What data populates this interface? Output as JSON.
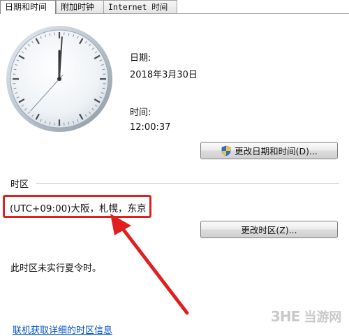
{
  "tabs": [
    {
      "label": "日期和时间",
      "active": true
    },
    {
      "label": "附加时钟",
      "active": false
    },
    {
      "label": "Internet 时间",
      "active": false
    }
  ],
  "clock": {
    "hour": 12,
    "minute": 0,
    "second": 37
  },
  "date": {
    "label": "日期:",
    "value": "2018年3月30日"
  },
  "time": {
    "label": "时间:",
    "value": "12:00:37"
  },
  "buttons": {
    "change_date": "更改日期和时间(D)...",
    "change_timezone": "更改时区(Z)..."
  },
  "timezone": {
    "section_label": "时区",
    "value": "(UTC+09:00)大阪，札幌，东京",
    "dst_note": "此时区未实行夏令时。"
  },
  "bottom_link": "联机获取详细的时区信息",
  "watermark": {
    "logo": "3HE",
    "text": "当游网"
  },
  "colors": {
    "highlight": "#e02020",
    "link": "#0050c8"
  }
}
